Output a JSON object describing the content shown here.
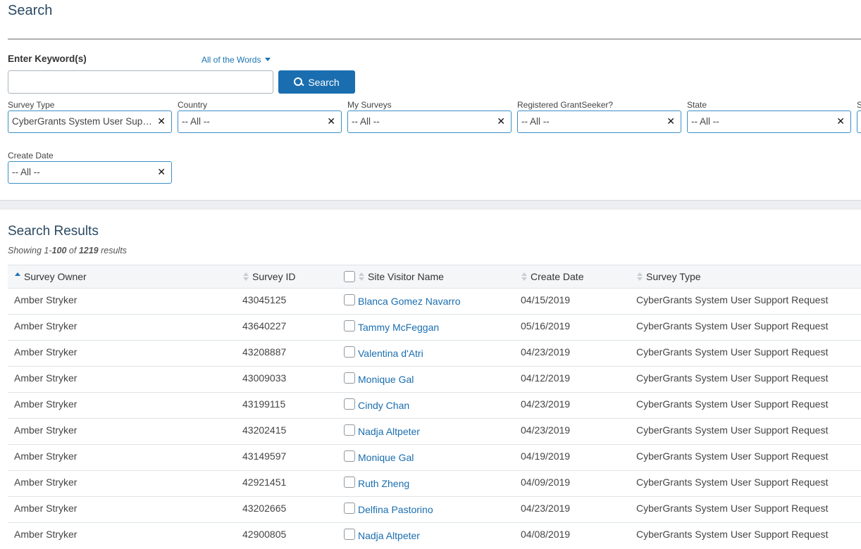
{
  "page": {
    "title": "Search"
  },
  "keyword": {
    "label": "Enter Keyword(s)",
    "mode": "All of the Words",
    "value": "",
    "search_button": "Search"
  },
  "filters": [
    {
      "label": "Survey Type",
      "value": "CyberGrants System User Support Request"
    },
    {
      "label": "Country",
      "value": "-- All --"
    },
    {
      "label": "My Surveys",
      "value": "-- All --"
    },
    {
      "label": "Registered GrantSeeker?",
      "value": "-- All --"
    },
    {
      "label": "State",
      "value": "-- All --"
    },
    {
      "label": "S",
      "value": ""
    },
    {
      "label": "Create Date",
      "value": "-- All --"
    }
  ],
  "results": {
    "title": "Search Results",
    "showing_prefix": "Showing 1-",
    "showing_to": "100",
    "showing_of": "of",
    "showing_total": "1219",
    "showing_suffix": "results",
    "columns": {
      "owner": "Survey Owner",
      "id": "Survey ID",
      "visitor": "Site Visitor Name",
      "date": "Create Date",
      "type": "Survey Type"
    },
    "rows": [
      {
        "owner": "Amber Stryker",
        "id": "43045125",
        "visitor": "Blanca Gomez Navarro",
        "date": "04/15/2019",
        "type": "CyberGrants System User Support Request"
      },
      {
        "owner": "Amber Stryker",
        "id": "43640227",
        "visitor": "Tammy McFeggan",
        "date": "05/16/2019",
        "type": "CyberGrants System User Support Request"
      },
      {
        "owner": "Amber Stryker",
        "id": "43208887",
        "visitor": "Valentina d'Atri",
        "date": "04/23/2019",
        "type": "CyberGrants System User Support Request"
      },
      {
        "owner": "Amber Stryker",
        "id": "43009033",
        "visitor": "Monique Gal",
        "date": "04/12/2019",
        "type": "CyberGrants System User Support Request"
      },
      {
        "owner": "Amber Stryker",
        "id": "43199115",
        "visitor": "Cindy Chan",
        "date": "04/23/2019",
        "type": "CyberGrants System User Support Request"
      },
      {
        "owner": "Amber Stryker",
        "id": "43202415",
        "visitor": "Nadja Altpeter",
        "date": "04/23/2019",
        "type": "CyberGrants System User Support Request"
      },
      {
        "owner": "Amber Stryker",
        "id": "43149597",
        "visitor": "Monique Gal",
        "date": "04/19/2019",
        "type": "CyberGrants System User Support Request"
      },
      {
        "owner": "Amber Stryker",
        "id": "42921451",
        "visitor": "Ruth Zheng",
        "date": "04/09/2019",
        "type": "CyberGrants System User Support Request"
      },
      {
        "owner": "Amber Stryker",
        "id": "43202665",
        "visitor": "Delfina Pastorino",
        "date": "04/23/2019",
        "type": "CyberGrants System User Support Request"
      },
      {
        "owner": "Amber Stryker",
        "id": "42900805",
        "visitor": "Nadja Altpeter",
        "date": "04/08/2019",
        "type": "CyberGrants System User Support Request"
      }
    ]
  },
  "icons": {
    "search": "search-icon",
    "clear": "close-icon",
    "sort_ascending": "sort-asc-icon",
    "sortable": "sort-icon",
    "dropdown": "caret-down-icon"
  },
  "colors": {
    "accent": "#1a6eb0",
    "title": "#2b4a63",
    "select_border": "#3c8fc7"
  }
}
